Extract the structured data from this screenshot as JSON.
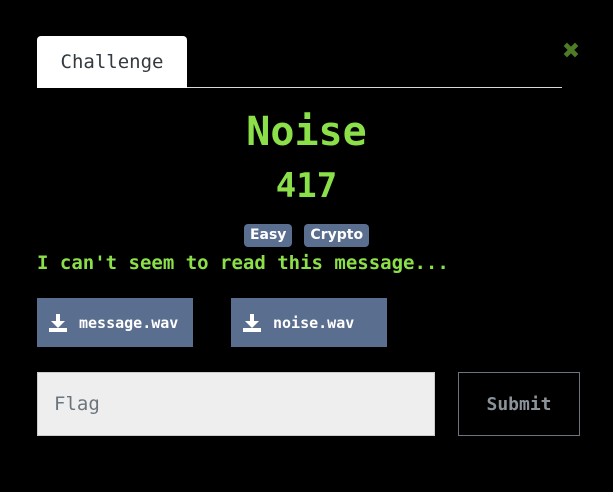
{
  "modal": {
    "tab_label": "Challenge",
    "close_icon": "close-icon",
    "close_glyph": "✖",
    "close_color": "#4e7b25"
  },
  "challenge": {
    "name": "Noise",
    "value": "417",
    "tags": [
      "Easy",
      "Crypto"
    ],
    "description": "I can't seem to read this message...",
    "accent_color": "#8be04a"
  },
  "files": [
    {
      "label": "message.wav",
      "icon": "download-icon"
    },
    {
      "label": "noise.wav",
      "icon": "download-icon"
    }
  ],
  "submission": {
    "placeholder": "Flag",
    "value": "",
    "submit_label": "Submit"
  },
  "colors": {
    "background": "#000000",
    "tag_bg": "#5a6e8f",
    "button_bg": "#5a6e8f"
  }
}
